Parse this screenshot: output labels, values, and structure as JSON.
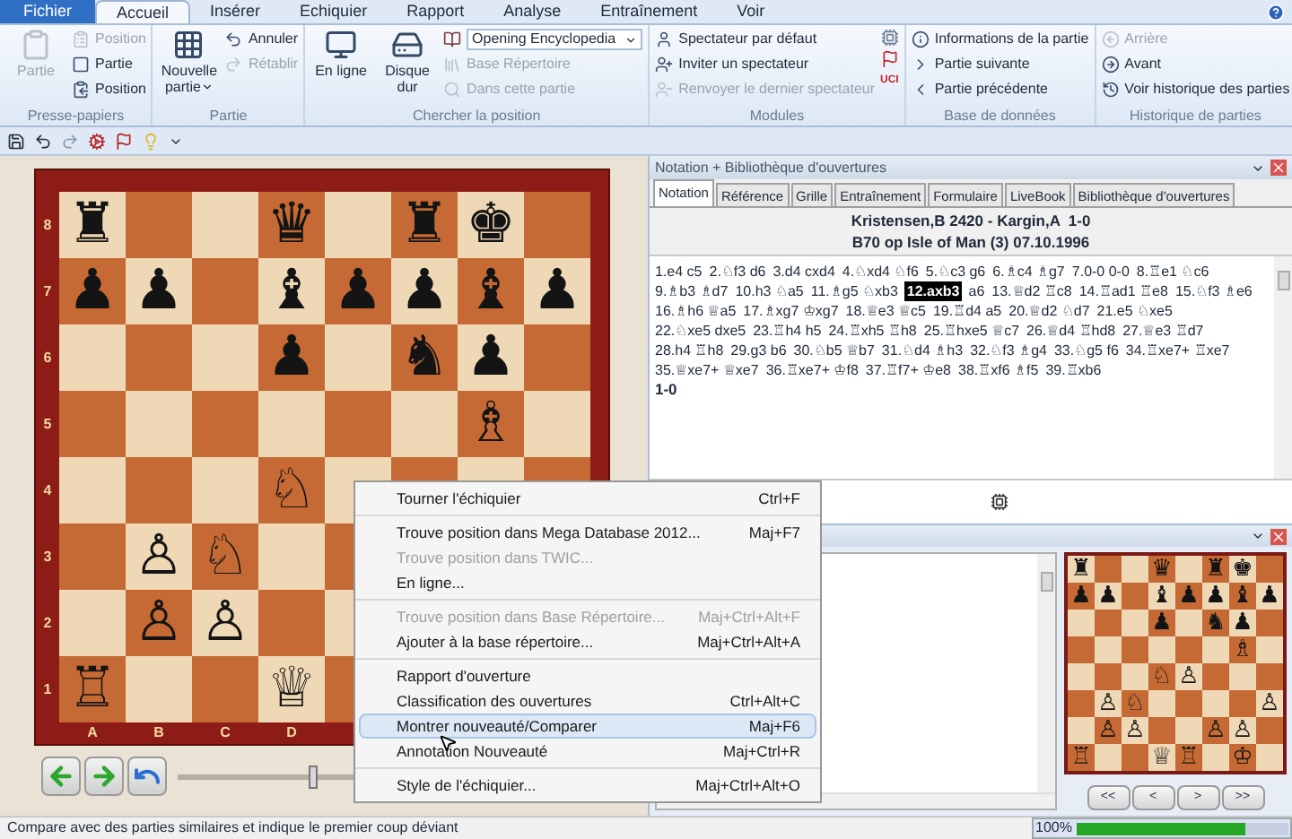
{
  "ribbon": {
    "tabs": [
      {
        "label": "Fichier",
        "kind": "file",
        "selected": false
      },
      {
        "label": "Accueil",
        "kind": "tab",
        "selected": true
      },
      {
        "label": "Insérer",
        "kind": "tab",
        "selected": false
      },
      {
        "label": "Echiquier",
        "kind": "tab",
        "selected": false
      },
      {
        "label": "Rapport",
        "kind": "tab",
        "selected": false
      },
      {
        "label": "Analyse",
        "kind": "tab",
        "selected": false
      },
      {
        "label": "Entraînement",
        "kind": "tab",
        "selected": false
      },
      {
        "label": "Voir",
        "kind": "tab",
        "selected": false
      }
    ],
    "groups": [
      {
        "title": "Presse-papiers",
        "columns": [
          {
            "kind": "large",
            "label": "Partie",
            "disabled": true,
            "menu": false
          },
          {
            "kind": "stack",
            "items": [
              {
                "label": "Position",
                "disabled": true
              },
              {
                "label": "Partie",
                "disabled": false
              },
              {
                "label": "Position",
                "disabled": false
              }
            ]
          }
        ]
      },
      {
        "title": "Partie",
        "columns": [
          {
            "kind": "large",
            "label": "Nouvelle partie",
            "disabled": false,
            "menu": true
          },
          {
            "kind": "stack",
            "items": [
              {
                "label": "Annuler",
                "disabled": false
              },
              {
                "label": "Rétablir",
                "disabled": true
              }
            ]
          }
        ]
      },
      {
        "title": "Chercher la position",
        "columns": [
          {
            "kind": "large",
            "label": "En ligne",
            "disabled": false,
            "menu": false
          },
          {
            "kind": "large",
            "label": "Disque dur",
            "disabled": false,
            "menu": false
          },
          {
            "kind": "stack",
            "items": [
              {
                "label": "Opening Encyclopedia",
                "disabled": false,
                "select": true
              },
              {
                "label": "Base Répertoire",
                "disabled": true
              },
              {
                "label": "Dans cette partie",
                "disabled": true
              }
            ]
          }
        ]
      },
      {
        "title": "Modules",
        "columns": [
          {
            "kind": "stack",
            "items": [
              {
                "label": "Spectateur par défaut",
                "disabled": false
              },
              {
                "label": "Inviter un spectateur",
                "disabled": false
              },
              {
                "label": "Renvoyer le dernier spectateur",
                "disabled": true
              }
            ]
          },
          {
            "kind": "icons",
            "badge": "UCI"
          }
        ]
      },
      {
        "title": "Base de données",
        "columns": [
          {
            "kind": "stack",
            "items": [
              {
                "label": "Informations de la partie",
                "disabled": false
              },
              {
                "label": "Partie suivante",
                "disabled": false
              },
              {
                "label": "Partie précédente",
                "disabled": false
              }
            ]
          }
        ]
      },
      {
        "title": "Historique de parties",
        "columns": [
          {
            "kind": "stack",
            "items": [
              {
                "label": "Arrière",
                "disabled": true
              },
              {
                "label": "Avant",
                "disabled": false
              },
              {
                "label": "Voir historique des parties",
                "disabled": false
              }
            ]
          }
        ]
      }
    ]
  },
  "board": {
    "rows": [
      [
        "♜",
        null,
        null,
        "♛",
        null,
        "♜",
        "♚",
        null
      ],
      [
        "♟",
        "♟",
        null,
        "♝",
        "♟",
        "♟",
        "♝",
        "♟"
      ],
      [
        null,
        null,
        null,
        "♟",
        null,
        "♞",
        "♟",
        null
      ],
      [
        null,
        null,
        null,
        null,
        null,
        null,
        "♗",
        null
      ],
      [
        null,
        null,
        null,
        "♘",
        null,
        null,
        null,
        null
      ],
      [
        null,
        "♙",
        "♘",
        null,
        null,
        null,
        null,
        null
      ],
      [
        null,
        "♙",
        "♙",
        null,
        null,
        null,
        null,
        null
      ],
      [
        "♖",
        null,
        null,
        "♕",
        null,
        null,
        null,
        null
      ]
    ],
    "rank_labels": [
      "8",
      "7",
      "6",
      "5",
      "4",
      "3",
      "2",
      "1"
    ],
    "file_labels": [
      "A",
      "B",
      "C",
      "D"
    ],
    "slider": {
      "level": 0.28
    }
  },
  "notation_panel": {
    "title": "Notation + Bibliothèque d'ouvertures",
    "tabs": [
      {
        "label": "Notation",
        "selected": true
      },
      {
        "label": "Référence",
        "selected": false
      },
      {
        "label": "Grille",
        "selected": false
      },
      {
        "label": "Entraînement",
        "selected": false
      },
      {
        "label": "Formulaire",
        "selected": false
      },
      {
        "label": "LiveBook",
        "selected": false
      },
      {
        "label": "Bibliothèque d'ouvertures",
        "selected": false
      }
    ],
    "players": "Kristensen,B 2420 - Kargin,A  1-0",
    "event": "B70 op Isle of Man (3) 07.10.1996",
    "moves": [
      {
        "text": "1.e4 c5",
        "selected": false
      },
      {
        "text": "2.♘f3 d6",
        "selected": false
      },
      {
        "text": "3.d4 cxd4",
        "selected": false
      },
      {
        "text": "4.♘xd4 ♘f6",
        "selected": false
      },
      {
        "text": "5.♘c3 g6",
        "selected": false
      },
      {
        "text": "6.♗c4 ♗g7",
        "selected": false
      },
      {
        "text": "7.0-0 0-0",
        "selected": false
      },
      {
        "text": "8.♖e1 ♘c6",
        "selected": false
      },
      {
        "text": "9.♗b3 ♗d7",
        "selected": false
      },
      {
        "text": "10.h3 ♘a5",
        "selected": false
      },
      {
        "text": "11.♗g5 ♘xb3",
        "selected": false
      },
      {
        "text": "12.axb3",
        "selected": true
      },
      {
        "text": "a6",
        "selected": false
      },
      {
        "text": "13.♕d2 ♖c8",
        "selected": false
      },
      {
        "text": "14.♖ad1 ♖e8",
        "selected": false
      },
      {
        "text": "15.♘f3 ♗e6",
        "selected": false
      },
      {
        "text": "16.♗h6 ♕a5",
        "selected": false
      },
      {
        "text": "17.♗xg7 ♔xg7",
        "selected": false
      },
      {
        "text": "18.♕e3 ♕c5",
        "selected": false
      },
      {
        "text": "19.♖d4 a5",
        "selected": false
      },
      {
        "text": "20.♕d2 ♘d7",
        "selected": false
      },
      {
        "text": "21.e5 ♘xe5",
        "selected": false
      },
      {
        "text": "22.♘xe5 dxe5",
        "selected": false
      },
      {
        "text": "23.♖h4 h5",
        "selected": false
      },
      {
        "text": "24.♖xh5 ♖h8",
        "selected": false
      },
      {
        "text": "25.♖hxe5 ♕c7",
        "selected": false
      },
      {
        "text": "26.♕d4 ♖hd8",
        "selected": false
      },
      {
        "text": "27.♕e3 ♖d7",
        "selected": false
      },
      {
        "text": "28.h4 ♖h8",
        "selected": false
      },
      {
        "text": "29.g3 b6",
        "selected": false
      },
      {
        "text": "30.♘b5 ♕b7",
        "selected": false
      },
      {
        "text": "31.♘d4 ♗h3",
        "selected": false
      },
      {
        "text": "32.♘f3 ♗g4",
        "selected": false
      },
      {
        "text": "33.♘g5 f6",
        "selected": false
      },
      {
        "text": "34.♖xe7+ ♖xe7",
        "selected": false
      },
      {
        "text": "35.♕xe7+ ♕xe7",
        "selected": false
      },
      {
        "text": "36.♖xe7+ ♔f8",
        "selected": false
      },
      {
        "text": "37.♖f7+ ♔e8",
        "selected": false
      },
      {
        "text": "38.♖xf6 ♗f5",
        "selected": false
      },
      {
        "text": "39.♖xb6",
        "selected": false
      }
    ],
    "result": "1-0"
  },
  "mini_board": {
    "rows": [
      [
        "♜",
        null,
        null,
        "♛",
        null,
        "♜",
        "♚",
        null
      ],
      [
        "♟",
        "♟",
        null,
        "♝",
        "♟",
        "♟",
        "♝",
        "♟"
      ],
      [
        null,
        null,
        null,
        "♟",
        null,
        "♞",
        "♟",
        null
      ],
      [
        null,
        null,
        null,
        null,
        null,
        null,
        "♗",
        null
      ],
      [
        null,
        null,
        null,
        "♘",
        "♙",
        null,
        null,
        null
      ],
      [
        null,
        "♙",
        "♘",
        null,
        null,
        null,
        null,
        "♙"
      ],
      [
        null,
        "♙",
        "♙",
        null,
        null,
        "♙",
        "♙",
        null
      ],
      [
        "♖",
        null,
        null,
        "♕",
        "♖",
        null,
        "♔",
        null
      ]
    ],
    "buttons": [
      "<<",
      "<",
      ">",
      ">>"
    ]
  },
  "context_menu": {
    "groups": [
      [
        {
          "label": "Tourner l'échiquier",
          "shortcut": "Ctrl+F",
          "disabled": false,
          "selected": false
        }
      ],
      [
        {
          "label": "Trouve position dans Mega Database 2012...",
          "shortcut": "Maj+F7",
          "disabled": false,
          "selected": false
        },
        {
          "label": "Trouve position dans TWIC...",
          "disabled": true,
          "selected": false
        },
        {
          "label": "En ligne...",
          "disabled": false,
          "selected": false
        }
      ],
      [
        {
          "label": "Trouve position dans Base Répertoire...",
          "shortcut": "Maj+Ctrl+Alt+F",
          "disabled": true,
          "selected": false
        },
        {
          "label": "Ajouter à la base répertoire...",
          "shortcut": "Maj+Ctrl+Alt+A",
          "disabled": false,
          "selected": false
        }
      ],
      [
        {
          "label": "Rapport d'ouverture",
          "disabled": false,
          "selected": false
        },
        {
          "label": "Classification des ouvertures",
          "shortcut": "Ctrl+Alt+C",
          "disabled": false,
          "selected": false
        },
        {
          "label": "Montrer nouveauté/Comparer",
          "shortcut": "Maj+F6",
          "disabled": false,
          "selected": true
        },
        {
          "label": "Annotation Nouveauté",
          "shortcut": "Maj+Ctrl+R",
          "disabled": false,
          "selected": false
        }
      ],
      [
        {
          "label": "Style de l'échiquier...",
          "shortcut": "Maj+Ctrl+Alt+O",
          "disabled": false,
          "selected": false
        }
      ]
    ]
  },
  "status_bar": {
    "message": "Compare avec des parties similaires et indique le premier coup déviant",
    "zoom": "100%",
    "level": 0.8
  }
}
